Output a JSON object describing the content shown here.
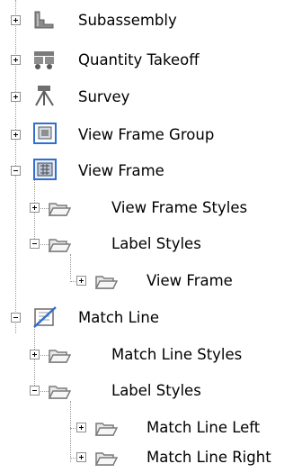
{
  "tree": {
    "subassembly": {
      "label": "Subassembly",
      "icon": "subassembly-icon",
      "state": "collapsed"
    },
    "quantity_takeoff": {
      "label": "Quantity Takeoff",
      "icon": "quantity-takeoff-icon",
      "state": "collapsed"
    },
    "survey": {
      "label": "Survey",
      "icon": "survey-tripod-icon",
      "state": "collapsed"
    },
    "view_frame_group": {
      "label": "View Frame Group",
      "icon": "view-frame-group-icon",
      "state": "collapsed"
    },
    "view_frame": {
      "label": "View Frame",
      "icon": "view-frame-icon",
      "state": "expanded",
      "styles": {
        "label": "View Frame Styles",
        "icon": "folder-icon",
        "state": "collapsed"
      },
      "label_styles": {
        "label": "Label Styles",
        "icon": "folder-icon",
        "state": "expanded",
        "children": [
          {
            "label": "View Frame",
            "icon": "folder-icon",
            "state": "collapsed"
          }
        ]
      }
    },
    "match_line": {
      "label": "Match Line",
      "icon": "match-line-icon",
      "state": "expanded",
      "styles": {
        "label": "Match Line Styles",
        "icon": "folder-icon",
        "state": "collapsed"
      },
      "label_styles": {
        "label": "Label Styles",
        "icon": "folder-icon",
        "state": "expanded",
        "children": [
          {
            "label": "Match Line Left",
            "icon": "folder-icon",
            "state": "collapsed"
          },
          {
            "label": "Match Line Right",
            "icon": "folder-icon",
            "state": "collapsed"
          }
        ]
      }
    }
  },
  "colors": {
    "icon_gray": "#7c7c7c",
    "icon_blue": "#2f6fd0",
    "folder_fill": "#e9e9e9",
    "folder_stroke": "#7a7a7a",
    "tree_line": "#9a9a9a"
  }
}
